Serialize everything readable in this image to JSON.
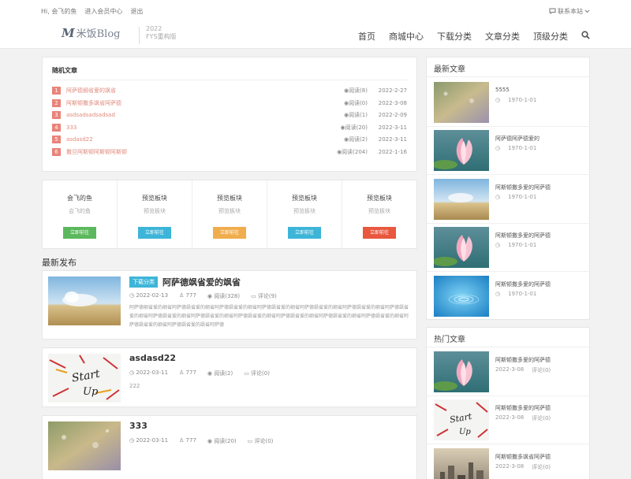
{
  "topbar": {
    "greeting": "Hi, 会飞的鱼",
    "member_center": "进入会员中心",
    "logout": "退出",
    "contact": "联系本站"
  },
  "header": {
    "logo_mark": "M",
    "logo_text": "米饭Blog",
    "slogan_line1": "2022",
    "slogan_line2": "FYS重构版",
    "nav": [
      "首页",
      "商城中心",
      "下载分类",
      "文章分类",
      "顶级分类"
    ]
  },
  "random": {
    "title": "随机文章",
    "items": [
      {
        "n": "1",
        "title": "阿萨德纲省爱的飒省",
        "reads": "阅读(8)",
        "date": "2022-2-27"
      },
      {
        "n": "2",
        "title": "阿斯顿撒多飒省阿萨德",
        "reads": "阅读(0)",
        "date": "2022-3-08"
      },
      {
        "n": "3",
        "title": "asdsadsadsadsad",
        "reads": "阅读(1)",
        "date": "2022-2-09"
      },
      {
        "n": "4",
        "title": "333",
        "reads": "阅读(20)",
        "date": "2022-3-11"
      },
      {
        "n": "5",
        "title": "asdasd22",
        "reads": "阅读(2)",
        "date": "2022-3-11"
      },
      {
        "n": "6",
        "title": "撒旦阿斯顿阿斯顿阿斯顿",
        "reads": "阅读(204)",
        "date": "2022-1-16"
      }
    ]
  },
  "blocks": [
    {
      "title": "会飞的鱼",
      "sub": "会飞的鱼",
      "btn": "立即前往",
      "color": "#5cb85c"
    },
    {
      "title": "预览板块",
      "sub": "预览板块",
      "btn": "立即前往",
      "color": "#3db5d8"
    },
    {
      "title": "预览板块",
      "sub": "预览板块",
      "btn": "立即前往",
      "color": "#f0ad4e"
    },
    {
      "title": "预览板块",
      "sub": "预览板块",
      "btn": "立即前往",
      "color": "#3db5d8"
    },
    {
      "title": "预览板块",
      "sub": "预览板块",
      "btn": "立即前往",
      "color": "#e9573f"
    }
  ],
  "latest": {
    "title": "最新发布",
    "posts": [
      {
        "tag": "下载分类",
        "title": "阿萨德飒省爱的飒省",
        "date": "2022-02-13",
        "author": "777",
        "reads": "阅读(328)",
        "comments": "评论(9)",
        "excerpt": "阿萨德纲省爱的纲省阿萨德飒省爱的纲省阿萨德飒省爱的纲省阿萨德飒省爱的纲省阿萨德飒省爱的纲省阿萨德飒省爱的纲省阿萨德飒省爱的纲省阿萨德飒省爱的纲省阿萨德飒省爱的纲省阿萨德飒省爱的纲省阿萨德飒省爱的纲省阿萨德飒省爱的纲省阿萨德飒省爱的纲省阿萨德飒省爱的纲省阿萨德飒省爱的飒省阿萨德"
      },
      {
        "tag": "",
        "title": "asdasd22",
        "date": "2022-03-11",
        "author": "777",
        "reads": "阅读(2)",
        "comments": "评论(0)",
        "excerpt": "222"
      },
      {
        "tag": "",
        "title": "333",
        "date": "2022-03-11",
        "author": "777",
        "reads": "阅读(20)",
        "comments": "评论(0)",
        "excerpt": ""
      }
    ]
  },
  "sidebar_latest": {
    "title": "最新文章",
    "items": [
      {
        "name": "5555",
        "date": "1970-1-01",
        "thumb": "rain"
      },
      {
        "name": "阿萨德阿萨德爱的",
        "date": "1970-1-01",
        "thumb": "lotus"
      },
      {
        "name": "阿斯顿撒多爱的阿萨德",
        "date": "1970-1-01",
        "thumb": "field"
      },
      {
        "name": "阿斯顿撒多爱的阿萨德",
        "date": "1970-1-01",
        "thumb": "lotus"
      },
      {
        "name": "阿斯顿撒多爱的阿萨德",
        "date": "1970-1-01",
        "thumb": "water"
      }
    ]
  },
  "sidebar_hot": {
    "title": "热门文章",
    "items": [
      {
        "name": "阿斯顿撒多爱的阿萨德",
        "date": "2022-3-08",
        "comments": "评论(0)",
        "thumb": "lotus"
      },
      {
        "name": "阿斯顿撒多爱的阿萨德",
        "date": "2022-3-08",
        "comments": "评论(0)",
        "thumb": "startup"
      },
      {
        "name": "阿斯顿撒多飒省阿萨德",
        "date": "2022-3-08",
        "comments": "评论(0)",
        "thumb": "city"
      }
    ]
  }
}
